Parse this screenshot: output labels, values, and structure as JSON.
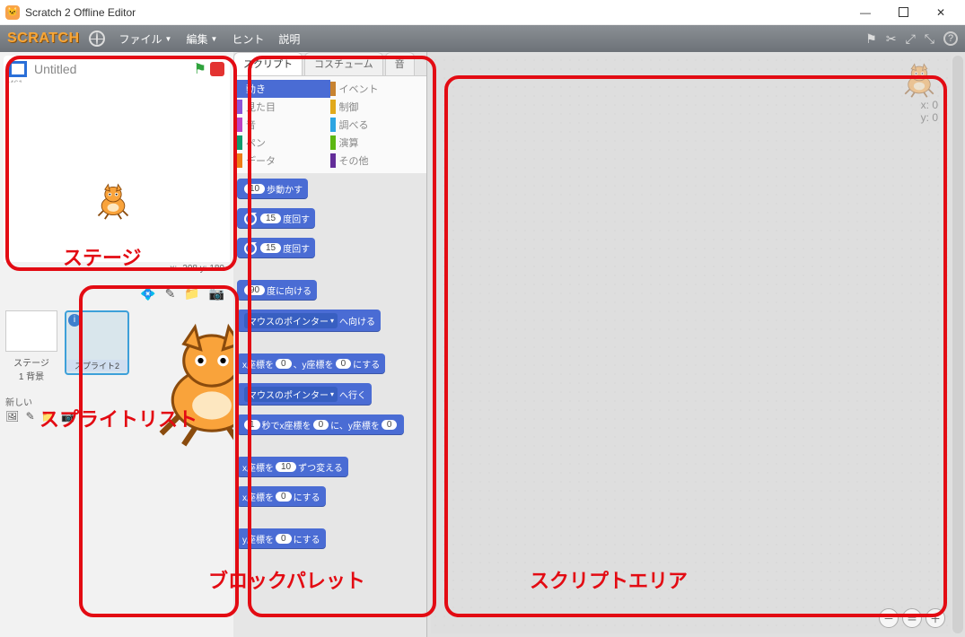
{
  "window": {
    "title": "Scratch 2 Offline Editor"
  },
  "menubar": {
    "logo": "SCRATCH",
    "items": [
      "ファイル",
      "編集",
      "ヒント",
      "説明"
    ]
  },
  "stage": {
    "project_title": "Untitled",
    "version_tag": "v461",
    "coord_text": "x: -208   y: 180"
  },
  "sprite_panel": {
    "stage_label": "ステージ",
    "backdrop_label": "1 背景",
    "new_label": "新しい",
    "sprite_name": "スプライト2"
  },
  "tabs": {
    "scripts": "スクリプト",
    "costumes": "コスチューム",
    "sounds": "音"
  },
  "categories": {
    "left": [
      {
        "name": "動き",
        "color": "#4a6cd4",
        "selected": true
      },
      {
        "name": "見た目",
        "color": "#8a55d7"
      },
      {
        "name": "音",
        "color": "#bb42c3"
      },
      {
        "name": "ペン",
        "color": "#0e9a6c"
      },
      {
        "name": "データ",
        "color": "#ee7d16"
      }
    ],
    "right": [
      {
        "name": "イベント",
        "color": "#c88330"
      },
      {
        "name": "制御",
        "color": "#e1a91a"
      },
      {
        "name": "調べる",
        "color": "#2ca5e2"
      },
      {
        "name": "演算",
        "color": "#5cb712"
      },
      {
        "name": "その他",
        "color": "#632d99"
      }
    ]
  },
  "blocks": {
    "b1_val": "10",
    "b1_text": "歩動かす",
    "b2_val": "15",
    "b2_text": "度回す",
    "b3_val": "15",
    "b3_text": "度回す",
    "b4_val": "90",
    "b4_text": "度に向ける",
    "b5_dd": "マウスのポインター",
    "b5_text": "へ向ける",
    "b6_pre": "x座標を",
    "b6_v1": "0",
    "b6_mid": "、y座標を",
    "b6_v2": "0",
    "b6_post": "にする",
    "b7_dd": "マウスのポインター",
    "b7_text": "へ行く",
    "b8_v1": "1",
    "b8_t1": "秒でx座標を",
    "b8_v2": "0",
    "b8_t2": "に、y座標を",
    "b8_v3": "0",
    "b9_pre": "x座標を",
    "b9_val": "10",
    "b9_post": "ずつ変える",
    "b10_pre": "x座標を",
    "b10_val": "0",
    "b10_post": "にする",
    "b11_pre": "y座標を",
    "b11_val": "0",
    "b11_post": "にする"
  },
  "script_area": {
    "x_label": "x: 0",
    "y_label": "y: 0"
  },
  "annotations": {
    "stage": "ステージ",
    "sprite_list": "スプライトリスト",
    "block_palette": "ブロックパレット",
    "script_area": "スクリプトエリア"
  }
}
